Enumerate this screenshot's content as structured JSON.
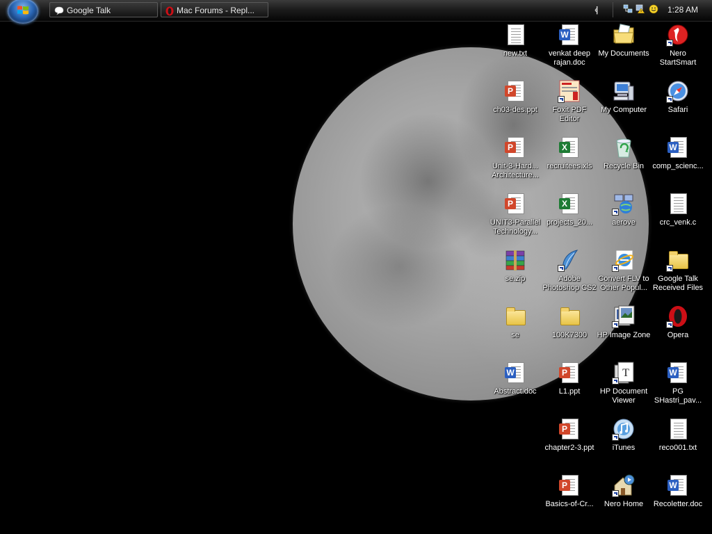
{
  "taskbar": {
    "start_label": "Start",
    "tasks": [
      {
        "label": "Google Talk",
        "icon": "google-talk-icon"
      },
      {
        "label": "Mac Forums - Repl...",
        "icon": "opera-icon"
      }
    ],
    "tray_expand_symbol": "‹|",
    "clock": "1:28 AM",
    "tray_icons": [
      "network-icon",
      "security-warning-icon",
      "messenger-smiley-icon"
    ]
  },
  "wallpaper": "moon",
  "icons": [
    {
      "label": "new.txt",
      "type": "txt",
      "shortcut": false
    },
    {
      "label": "venkat deep rajan.doc",
      "type": "doc",
      "shortcut": false
    },
    {
      "label": "My Documents",
      "type": "mydocs",
      "shortcut": false
    },
    {
      "label": "Nero StartSmart",
      "type": "nero",
      "shortcut": true
    },
    {
      "label": "ch03-des.ppt",
      "type": "ppt",
      "shortcut": false
    },
    {
      "label": "Foxit PDF Editor",
      "type": "foxit",
      "shortcut": true
    },
    {
      "label": "My Computer",
      "type": "mycomputer",
      "shortcut": false
    },
    {
      "label": "Safari",
      "type": "safari",
      "shortcut": true
    },
    {
      "label": "Unit-3-Hard... Architecture...",
      "type": "ppt",
      "shortcut": false
    },
    {
      "label": "recruitees.xls",
      "type": "xls",
      "shortcut": false
    },
    {
      "label": "Recycle Bin",
      "type": "recycle",
      "shortcut": false
    },
    {
      "label": "comp_scienc...",
      "type": "doc",
      "shortcut": false
    },
    {
      "label": "UNIT3-Parallel Technology...",
      "type": "ppt",
      "shortcut": false
    },
    {
      "label": "projects_20...",
      "type": "xls",
      "shortcut": false
    },
    {
      "label": "aerove",
      "type": "network",
      "shortcut": true
    },
    {
      "label": "crc_venk.c",
      "type": "txt",
      "shortcut": false
    },
    {
      "label": "se.zip",
      "type": "zip",
      "shortcut": false
    },
    {
      "label": "Adobe Photoshop CS2",
      "type": "photoshop",
      "shortcut": true
    },
    {
      "label": "Convert FLV to Other Popul...",
      "type": "ie",
      "shortcut": true
    },
    {
      "label": "Google Talk Received Files",
      "type": "folder",
      "shortcut": true
    },
    {
      "label": "se",
      "type": "folder",
      "shortcut": false
    },
    {
      "label": "100K7300",
      "type": "folder",
      "shortcut": false
    },
    {
      "label": "HP Image Zone",
      "type": "hpimage",
      "shortcut": true
    },
    {
      "label": "Opera",
      "type": "opera",
      "shortcut": true
    },
    {
      "label": "Abstract.doc",
      "type": "doc",
      "shortcut": false
    },
    {
      "label": "L1.ppt",
      "type": "ppt",
      "shortcut": false
    },
    {
      "label": "HP Document Viewer",
      "type": "hpdoc",
      "shortcut": true
    },
    {
      "label": "PG SHastri_pav...",
      "type": "doc",
      "shortcut": false
    },
    {
      "label": "chapter2-3.ppt",
      "type": "ppt",
      "shortcut": false
    },
    {
      "label": "iTunes",
      "type": "itunes",
      "shortcut": true
    },
    {
      "label": "reco001.txt",
      "type": "txt",
      "shortcut": false
    },
    {
      "label": "Basics-of-Cr...",
      "type": "ppt",
      "shortcut": false
    },
    {
      "label": "Nero Home",
      "type": "nerohome",
      "shortcut": true
    },
    {
      "label": "Recoletter.doc",
      "type": "doc",
      "shortcut": false
    }
  ],
  "colors": {
    "word": "#2b5fc1",
    "excel": "#1e7b34",
    "powerpoint": "#d1472b",
    "opera": "#cc0f16",
    "label": "#ffffff"
  }
}
